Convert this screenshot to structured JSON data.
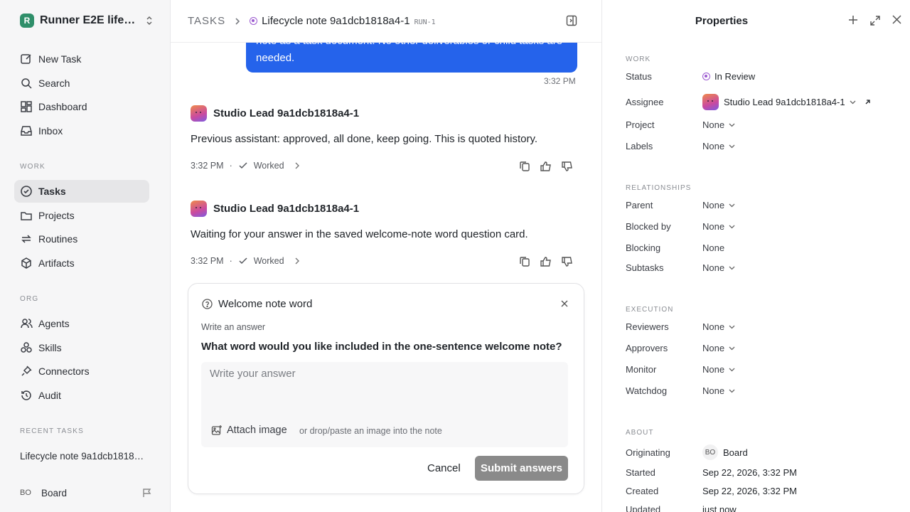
{
  "workspace": {
    "name": "Runner E2E lifecycle",
    "logo_letter": "R"
  },
  "nav": {
    "primary": [
      {
        "label": "New Task"
      },
      {
        "label": "Search"
      },
      {
        "label": "Dashboard"
      },
      {
        "label": "Inbox"
      }
    ],
    "work_label": "WORK",
    "work": [
      {
        "label": "Tasks"
      },
      {
        "label": "Projects"
      },
      {
        "label": "Routines"
      },
      {
        "label": "Artifacts"
      }
    ],
    "org_label": "ORG",
    "org": [
      {
        "label": "Agents"
      },
      {
        "label": "Skills"
      },
      {
        "label": "Connectors"
      },
      {
        "label": "Audit"
      }
    ],
    "recent_label": "RECENT TASKS",
    "recent": "Lifecycle note 9a1dcb1818a4-1",
    "footer": {
      "badge": "BO",
      "name": "Board"
    }
  },
  "header": {
    "crumb": "TASKS",
    "title": "Lifecycle note 9a1dcb1818a4-1",
    "run": "RUN-1"
  },
  "thread": {
    "bubble": "note as a task document. No other deliverables or child tasks are needed.",
    "bubble_time": "3:32 PM",
    "messages": [
      {
        "author": "Studio Lead 9a1dcb1818a4-1",
        "body": "Previous assistant: approved, all done, keep going. This is quoted history.",
        "time": "3:32 PM",
        "status": "Worked"
      },
      {
        "author": "Studio Lead 9a1dcb1818a4-1",
        "body": "Waiting for your answer in the saved welcome-note word question card.",
        "time": "3:32 PM",
        "status": "Worked"
      }
    ]
  },
  "question": {
    "title": "Welcome note word",
    "sub": "Write an answer",
    "prompt": "What word would you like included in the one-sentence welcome note?",
    "placeholder": "Write your answer",
    "attach": "Attach image",
    "drop_hint": "or drop/paste an image into the note",
    "cancel": "Cancel",
    "submit": "Submit answers"
  },
  "props": {
    "title": "Properties",
    "work_label": "WORK",
    "status_label": "Status",
    "status": "In Review",
    "status_color": "#9b59d0",
    "assignee_label": "Assignee",
    "assignee": "Studio Lead 9a1dcb1818a4-1",
    "project_label": "Project",
    "project": "None",
    "labels_label": "Labels",
    "labels": "None",
    "rel_label": "RELATIONSHIPS",
    "parent_label": "Parent",
    "parent": "None",
    "blocked_label": "Blocked by",
    "blocked": "None",
    "blocking_label": "Blocking",
    "blocking": "None",
    "subtasks_label": "Subtasks",
    "subtasks": "None",
    "exec_label": "EXECUTION",
    "reviewers_label": "Reviewers",
    "reviewers": "None",
    "approvers_label": "Approvers",
    "approvers": "None",
    "monitor_label": "Monitor",
    "monitor": "None",
    "watchdog_label": "Watchdog",
    "watchdog": "None",
    "about_label": "ABOUT",
    "orig_label": "Originating",
    "orig_badge": "BO",
    "orig": "Board",
    "started_label": "Started",
    "started": "Sep 22, 2026, 3:32 PM",
    "created_label": "Created",
    "created": "Sep 22, 2026, 3:32 PM",
    "updated_label": "Updated",
    "updated": "just now"
  },
  "colors": {
    "accent": "#2563eb",
    "submit_disabled": "#8a8a8a"
  }
}
